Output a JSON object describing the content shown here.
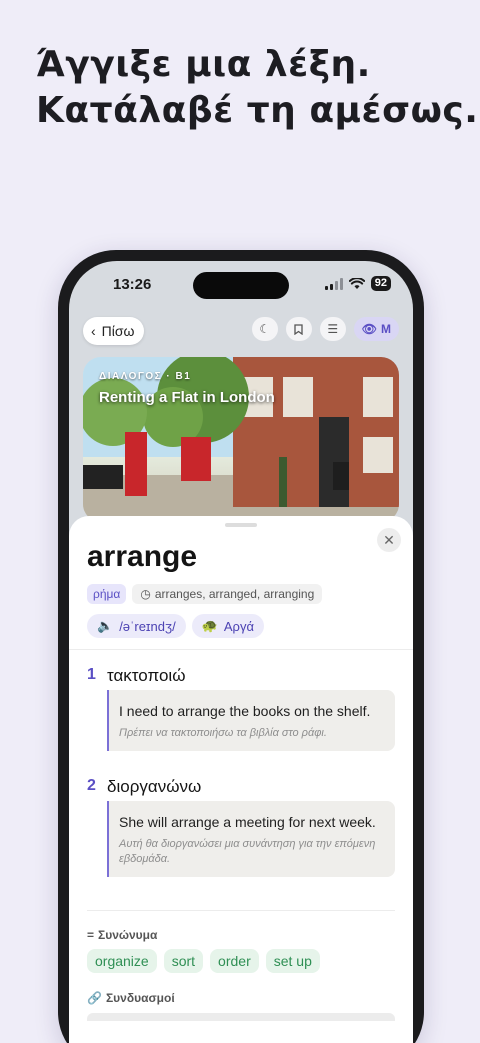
{
  "headline": {
    "line1": "Άγγιξε μια λέξη.",
    "line2": "Κατάλαβέ τη αμέσως."
  },
  "status_bar": {
    "time": "13:26",
    "battery": "92"
  },
  "topbar": {
    "back_label": "Πίσω",
    "mode_label": "M"
  },
  "hero": {
    "tag": "ΔΙΑΛΟΓΟΣ · B1",
    "title": "Renting a Flat in London"
  },
  "entry": {
    "word": "arrange",
    "part_of_speech": "ρήμα",
    "forms": "arranges, arranged, arranging",
    "ipa": "/əˈreɪndʒ/",
    "slow_label": "Αργά"
  },
  "senses": [
    {
      "num": "1",
      "translation": "τακτοποιώ",
      "example_en": "I need to arrange the books on the shelf.",
      "example_gr": "Πρέπει να τακτοποιήσω τα βιβλία στο ράφι."
    },
    {
      "num": "2",
      "translation": "διοργανώνω",
      "example_en": "She will arrange a meeting for next week.",
      "example_gr": "Αυτή θα διοργανώσει μια συνάντηση για την επόμενη εβδομάδα."
    }
  ],
  "synonyms": {
    "title": "Συνώνυμα",
    "items": [
      "organize",
      "sort",
      "order",
      "set up"
    ]
  },
  "collocations": {
    "title": "Συνδυασμοί"
  },
  "colors": {
    "accent": "#5a4fc4",
    "synonym": "#2f8f54",
    "background": "#efedf8"
  }
}
